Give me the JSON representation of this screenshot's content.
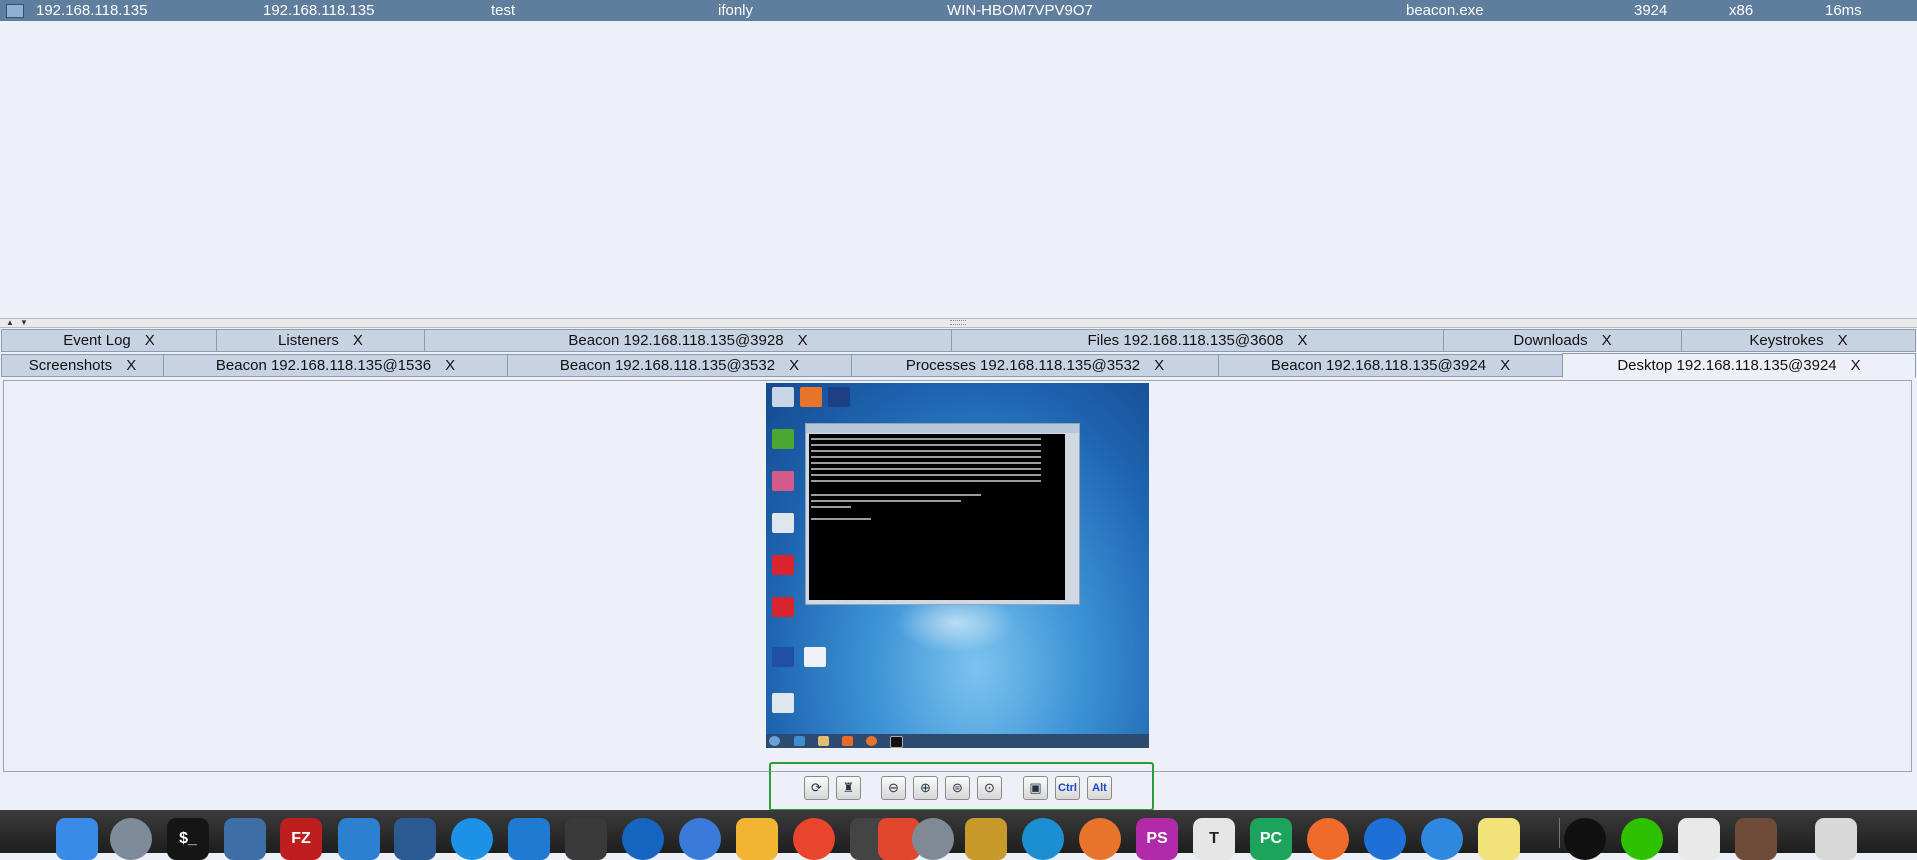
{
  "beacon": {
    "external_ip": "192.168.118.135",
    "internal_ip": "192.168.118.135",
    "listener": "test",
    "user": "ifonly",
    "computer": "WIN-HBOM7VPV9O7",
    "process": "beacon.exe",
    "pid": "3924",
    "arch": "x86",
    "last": "16ms"
  },
  "tabs_row1": [
    {
      "label": "Event Log",
      "close": "X"
    },
    {
      "label": "Listeners",
      "close": "X"
    },
    {
      "label": "Beacon 192.168.118.135@3928",
      "close": "X"
    },
    {
      "label": "Files 192.168.118.135@3608",
      "close": "X"
    },
    {
      "label": "Downloads",
      "close": "X"
    },
    {
      "label": "Keystrokes",
      "close": "X"
    }
  ],
  "tabs_row2": [
    {
      "label": "Screenshots",
      "close": "X"
    },
    {
      "label": "Beacon 192.168.118.135@1536",
      "close": "X"
    },
    {
      "label": "Beacon 192.168.118.135@3532",
      "close": "X"
    },
    {
      "label": "Processes 192.168.118.135@3532",
      "close": "X"
    },
    {
      "label": "Beacon 192.168.118.135@3924",
      "close": "X"
    },
    {
      "label": "Desktop 192.168.118.135@3924",
      "close": "X",
      "active": true
    }
  ],
  "toolbar": {
    "buttons": [
      {
        "name": "refresh-icon"
      },
      {
        "name": "view-only-icon"
      },
      {
        "name": "zoom-out-icon"
      },
      {
        "name": "zoom-in-icon"
      },
      {
        "name": "zoom-fit-icon"
      },
      {
        "name": "zoom-reset-icon"
      },
      {
        "name": "screenshot-icon"
      },
      {
        "name": "ctrl-key",
        "label": "Ctrl"
      },
      {
        "name": "alt-key",
        "label": "Alt"
      }
    ]
  },
  "colors": {
    "beacon_row": "#5f7d9c",
    "tab_bg": "#c7d3e3",
    "toolbar_border": "#2e9a3c",
    "dock_bg": "#2a2a2a"
  },
  "dock": [
    "finder-icon",
    "launchpad-icon",
    "terminal-icon",
    "remote-desktop-icon",
    "filezilla-icon",
    "network-icon",
    "virtualbox-icon",
    "docker-icon",
    "vscode-icon",
    "sublime-icon",
    "swift-icon",
    "vpn-icon",
    "notes-icon",
    "chrome-icon",
    "app-icon",
    "app-icon",
    "time-machine-icon",
    "app-icon",
    "edge-icon",
    "firefox-icon",
    "phpstorm-icon",
    "typora-icon",
    "pycharm-icon",
    "postman-icon",
    "app-icon",
    "app-icon",
    "notes-yellow-icon",
    "qq-icon",
    "wechat-icon",
    "java-icon",
    "app-icon",
    "trash-icon"
  ]
}
